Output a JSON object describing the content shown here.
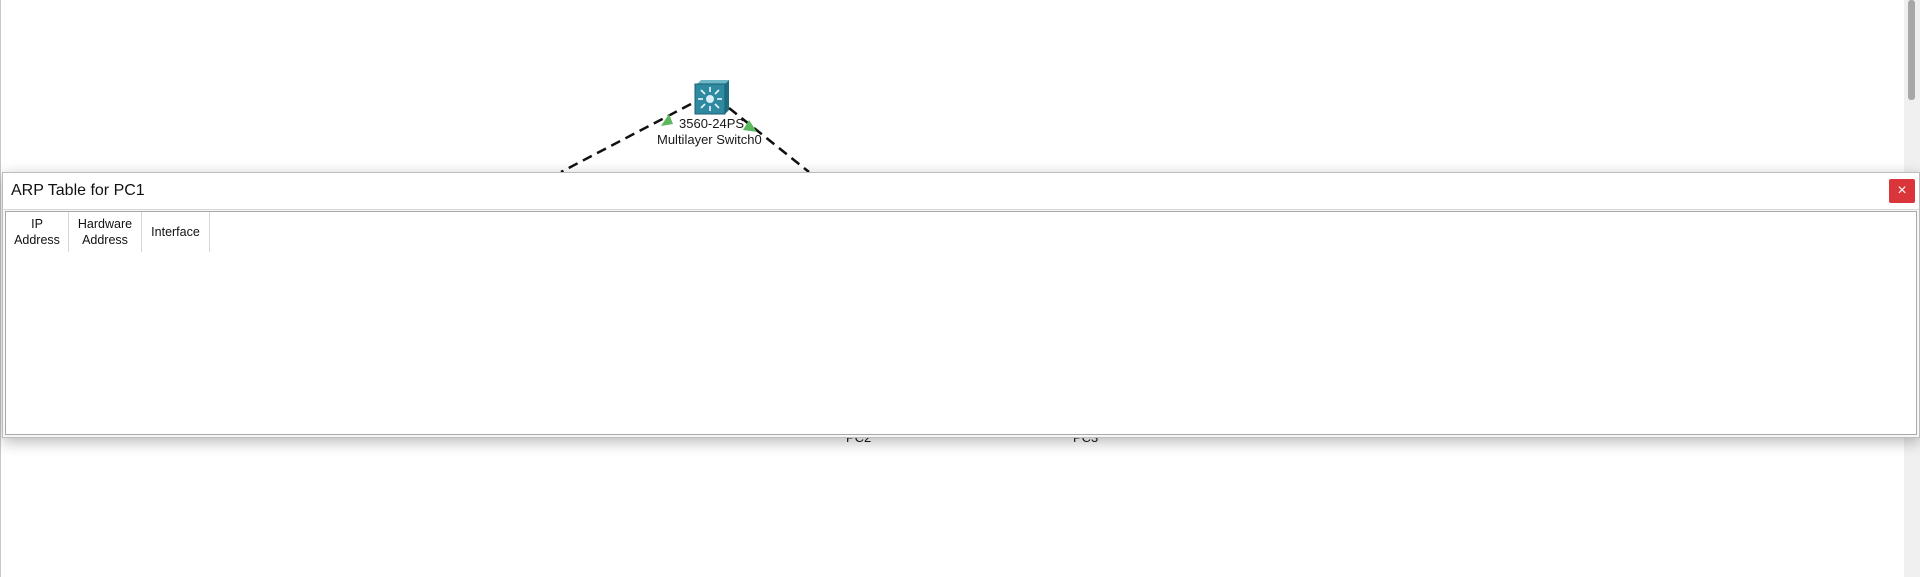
{
  "workspace": {
    "devices": [
      {
        "name": "Multilayer Switch0",
        "model": "3560-24PS",
        "icon": "multilayer-switch-icon"
      }
    ],
    "partial_labels": [
      "PC2",
      "PC3"
    ],
    "link_style": "dashed",
    "link_up_indicator_color": "#5cb85c"
  },
  "arp_dialog": {
    "title": "ARP Table for PC1",
    "close_icon": "close-icon",
    "close_glyph": "×",
    "close_color": "#d9353a",
    "columns": [
      {
        "label_line1": "IP",
        "label_line2": "Address"
      },
      {
        "label_line1": "Hardware",
        "label_line2": "Address"
      },
      {
        "label_line1": "Interface",
        "label_line2": ""
      }
    ],
    "rows": []
  }
}
